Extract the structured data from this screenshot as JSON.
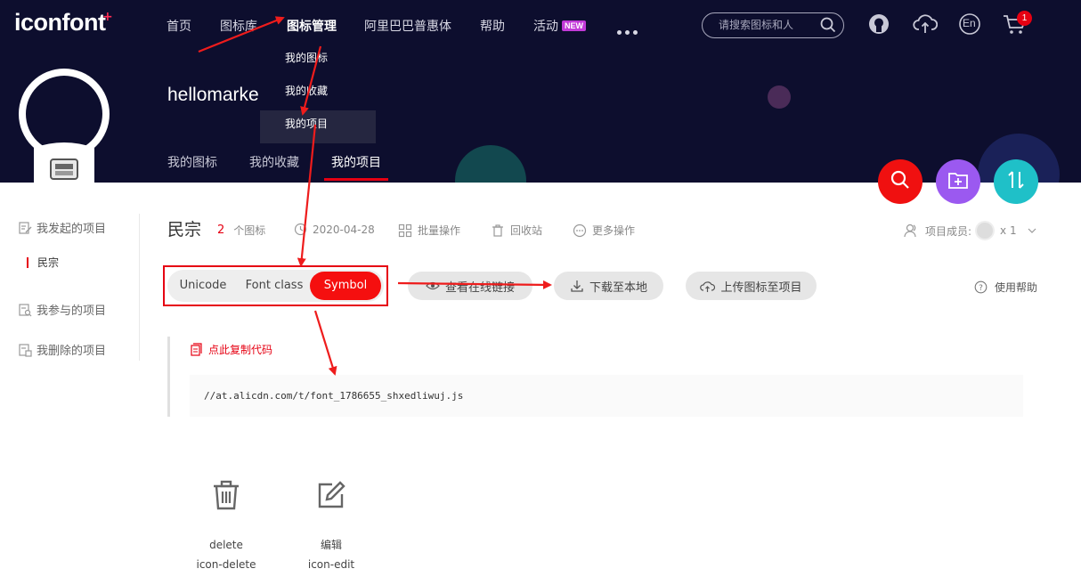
{
  "header": {
    "logo": "iconfont",
    "logo_plus": "+",
    "nav": [
      {
        "label": "首页"
      },
      {
        "label": "图标库"
      },
      {
        "label": "图标管理"
      },
      {
        "label": "阿里巴巴普惠体"
      },
      {
        "label": "帮助"
      },
      {
        "label": "活动",
        "badge": "NEW"
      }
    ],
    "search_placeholder": "请搜索图标和人",
    "lang": "En",
    "cart_count": "1",
    "dropdown": [
      "我的图标",
      "我的收藏",
      "我的项目"
    ],
    "username": "hellomarke",
    "subtabs": [
      "我的图标",
      "我的收藏",
      "我的项目"
    ]
  },
  "sidebar": {
    "initiated": "我发起的项目",
    "initiated_sub": "民宗",
    "joined": "我参与的项目",
    "deleted": "我删除的项目"
  },
  "project": {
    "title": "民宗",
    "icon_count": "2",
    "icon_count_label": "个图标",
    "date": "2020-04-28",
    "batch": "批量操作",
    "recycle": "回收站",
    "more": "更多操作",
    "members_label": "项目成员:",
    "members_count": "x 1"
  },
  "toolbar": {
    "types": [
      "Unicode",
      "Font class",
      "Symbol"
    ],
    "online_link": "查看在线链接",
    "download": "下载至本地",
    "upload": "上传图标至项目",
    "help": "使用帮助"
  },
  "code": {
    "copy": "点此复制代码",
    "url": "//at.alicdn.com/t/font_1786655_shxedliwuj.js"
  },
  "icons": [
    {
      "name": "delete",
      "class": "icon-delete",
      "icon": "trash-icon"
    },
    {
      "name": "编辑",
      "class": "icon-edit",
      "icon": "edit-icon"
    }
  ],
  "colors": {
    "header_bg": "#0d0e2e",
    "accent_red": "#e60012",
    "fab_search": "#f01010",
    "fab_folder": "#9b59f0",
    "fab_sort": "#1fc0c8"
  }
}
